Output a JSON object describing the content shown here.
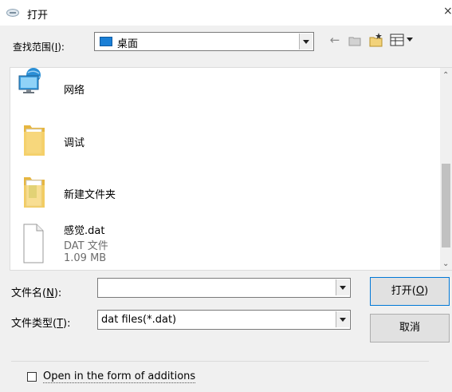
{
  "dialog": {
    "title": "打开",
    "close": "×"
  },
  "lookin": {
    "label": "查找范围(I):",
    "value": "桌面"
  },
  "toolbar": {
    "back_icon": "back-arrow-icon",
    "up_icon": "up-folder-icon",
    "new_icon": "new-folder-icon",
    "view_icon": "view-menu-icon"
  },
  "files": [
    {
      "name": "网络",
      "icon": "network-icon"
    },
    {
      "name": "调试",
      "icon": "folder-icon"
    },
    {
      "name": "新建文件夹",
      "icon": "folder-icon"
    },
    {
      "name": "感觉.dat",
      "type": "DAT 文件",
      "size": "1.09 MB",
      "icon": "file-icon"
    }
  ],
  "filename": {
    "label": "文件名(N):",
    "value": ""
  },
  "filetype": {
    "label": "文件类型(T):",
    "value": "dat files(*.dat)"
  },
  "buttons": {
    "open": "打开(O)",
    "cancel": "取消"
  },
  "options": {
    "additions_label": "Open in the form of additions",
    "additions_checked": false
  }
}
